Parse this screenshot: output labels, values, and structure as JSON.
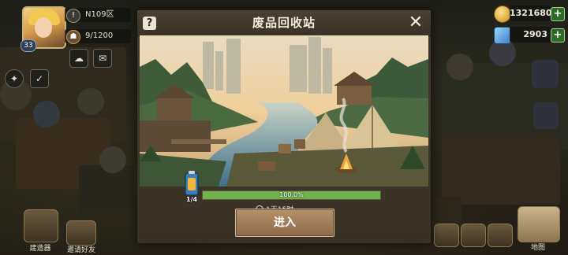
{
  "player": {
    "level": "33",
    "avatar": "female-blonde-portrait"
  },
  "hud": {
    "region": "N109区",
    "population": "9/1200",
    "region_icon": "shield-icon",
    "population_icon": "people-icon"
  },
  "resources": {
    "gold": "1321680",
    "gems": "2903",
    "gold_icon": "coin-icon",
    "gem_icon": "gem-icon"
  },
  "bottom_bar": {
    "left_label": "建造器",
    "left2_label": "邀请好友",
    "right_label": "地图"
  },
  "modal": {
    "title": "废品回收站",
    "help": "?",
    "close": "✕",
    "progress_percent": 100,
    "progress_text": "100.0%",
    "item_count": "1/4",
    "timer": "1天15时",
    "enter_label": "进入"
  },
  "colors": {
    "progress_fill": "#6fb34d",
    "button": "#a17b56",
    "panel": "#3d3428"
  }
}
